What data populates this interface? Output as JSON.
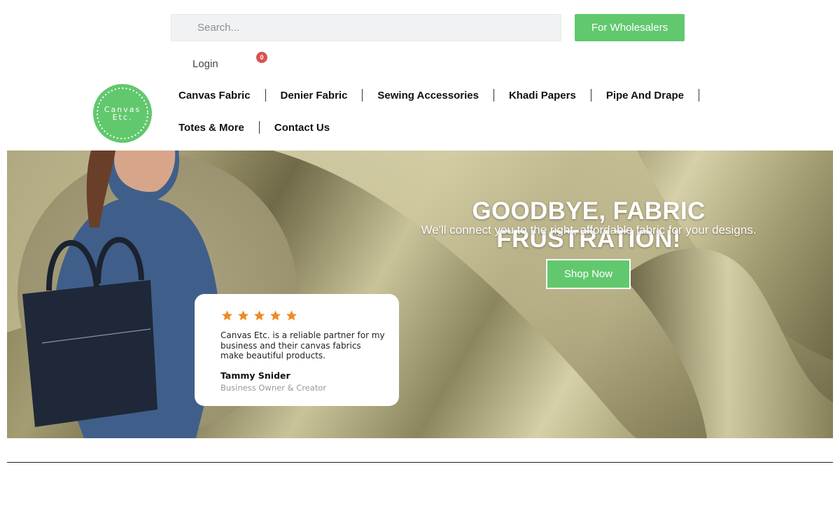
{
  "header": {
    "search": {
      "placeholder": "Search...",
      "value": ""
    },
    "wholesalers_label": "For Wholesalers",
    "login_label": "Login",
    "cart_count": "0"
  },
  "logo": {
    "line1": "Canvas",
    "line2": "Etc.",
    "color": "#62c86e"
  },
  "nav": {
    "row1": [
      "Canvas Fabric",
      "Denier Fabric",
      "Sewing Accessories",
      "Khadi Papers",
      "Pipe And Drape"
    ],
    "row2": [
      "Totes & More",
      "Contact Us"
    ]
  },
  "hero": {
    "title": "GOODBYE, FABRIC FRUSTRATION!",
    "subtitle": "We'll connect you to the right, affordable fabric for your designs.",
    "cta_label": "Shop Now"
  },
  "testimonial": {
    "rating": 5,
    "text": "Canvas Etc. is a reliable partner for my business and their canvas fabrics make beautiful products.",
    "name": "Tammy Snider",
    "role": "Business Owner & Creator"
  },
  "colors": {
    "accent": "#62c86e",
    "badge": "#d9534f",
    "star": "#f08a24"
  }
}
